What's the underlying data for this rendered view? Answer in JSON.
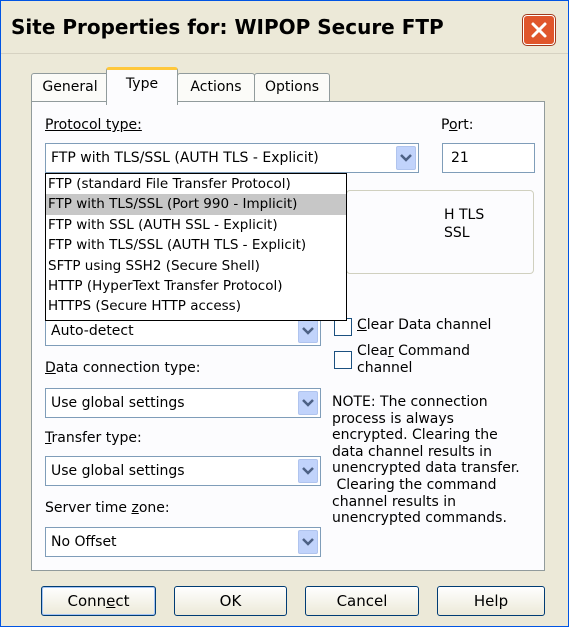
{
  "window": {
    "title": "Site Properties for: WIPOP Secure FTP",
    "accent_color": "#e0562c"
  },
  "tabs": [
    {
      "label": "General"
    },
    {
      "label": "Type",
      "active": true
    },
    {
      "label": "Actions"
    },
    {
      "label": "Options"
    }
  ],
  "protocol": {
    "label_pre": "Protocol type:",
    "selected": "FTP with TLS/SSL (AUTH TLS - Explicit)",
    "options": [
      "FTP (standard File Transfer Protocol)",
      "FTP with TLS/SSL (Port 990 - Implicit)",
      "FTP with SSL (AUTH SSL - Explicit)",
      "FTP with TLS/SSL (AUTH TLS - Explicit)",
      "SFTP using SSH2 (Secure Shell)",
      "HTTP (HyperText Transfer Protocol)",
      "HTTPS (Secure HTTP access)"
    ],
    "highlighted_index": 1
  },
  "port": {
    "label_a": "P",
    "label_u": "o",
    "label_b": "rt:",
    "value": "21"
  },
  "group": {
    "line1": "H TLS",
    "line2": "SSL"
  },
  "auto_detect": {
    "value": "Auto-detect"
  },
  "data_connection": {
    "label_u": "D",
    "label_rest": "ata connection type:",
    "value": "Use global settings"
  },
  "transfer": {
    "label_u": "T",
    "label_rest": "ransfer type:",
    "value": "Use global settings"
  },
  "timezone": {
    "label_a": "Server time ",
    "label_u": "z",
    "label_b": "one:",
    "value": "No Offset"
  },
  "clear_data": {
    "label_u": "C",
    "label_rest": "lear Data channel",
    "checked": false
  },
  "clear_command": {
    "label_a": "Clea",
    "label_u": "r",
    "label_b": " Command",
    "label_line2": "channel",
    "checked": false
  },
  "note": {
    "lines": [
      "NOTE: The connection",
      "process is always",
      "encrypted.  Clearing the",
      "data channel results in",
      "unencrypted data transfer.",
      " Clearing the command",
      "channel results in",
      "unencrypted commands."
    ]
  },
  "buttons": {
    "connect_a": "Conn",
    "connect_u": "e",
    "connect_b": "ct",
    "ok": "OK",
    "cancel": "Cancel",
    "help": "Help"
  }
}
